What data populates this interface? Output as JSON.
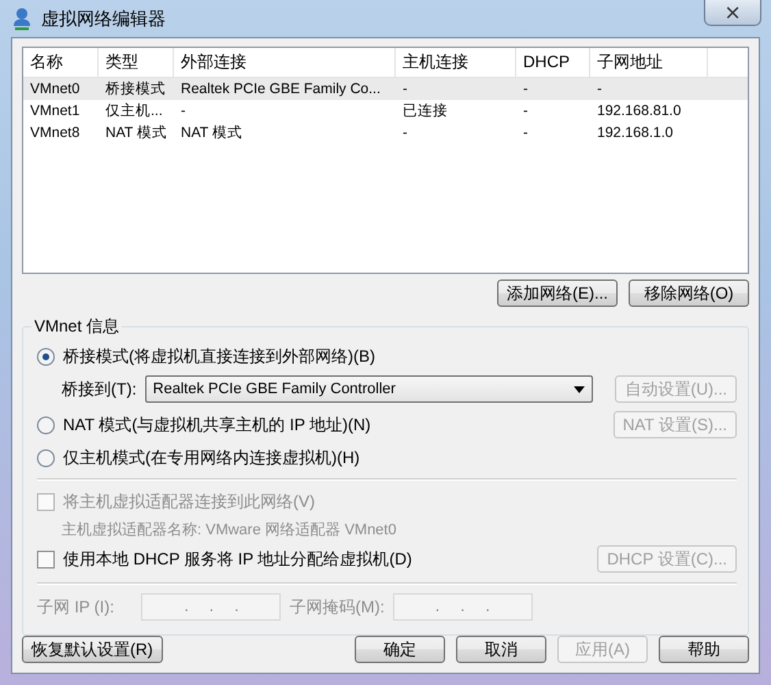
{
  "window": {
    "title": "虚拟网络编辑器",
    "close": "×"
  },
  "table": {
    "columns": [
      "名称",
      "类型",
      "外部连接",
      "主机连接",
      "DHCP",
      "子网地址"
    ],
    "rows": [
      {
        "cells": [
          "VMnet0",
          "桥接模式",
          "Realtek PCIe GBE Family Co...",
          "-",
          "-",
          "-"
        ],
        "selected": true
      },
      {
        "cells": [
          "VMnet1",
          "仅主机...",
          "-",
          "已连接",
          "-",
          "192.168.81.0"
        ],
        "selected": false
      },
      {
        "cells": [
          "VMnet8",
          "NAT 模式",
          "NAT 模式",
          "-",
          "-",
          "192.168.1.0"
        ],
        "selected": false
      }
    ]
  },
  "list_buttons": [
    {
      "label": "添加网络(E)...",
      "disabled": false
    },
    {
      "label": "移除网络(O)",
      "disabled": false
    }
  ],
  "group": {
    "title": "VMnet 信息",
    "modes": [
      {
        "label": "桥接模式(将虚拟机直接连接到外部网络)(B)",
        "selected": true
      },
      {
        "label": "NAT 模式(与虚拟机共享主机的 IP 地址)(N)",
        "selected": false
      },
      {
        "label": "仅主机模式(在专用网络内连接虚拟机)(H)",
        "selected": false
      }
    ],
    "bridge_label": "桥接到(T):",
    "bridge_value": "Realtek PCIe GBE Family Controller",
    "auto_button": {
      "label": "自动设置(U)...",
      "disabled": true
    },
    "nat_button": {
      "label": "NAT 设置(S)...",
      "disabled": true
    },
    "host_adapter": {
      "label": "将主机虚拟适配器连接到此网络(V)",
      "checked": false,
      "disabled": true
    },
    "adapter_name": {
      "text": "主机虚拟适配器名称: VMware 网络适配器 VMnet0",
      "disabled": true
    },
    "dhcp": {
      "label": "使用本地 DHCP 服务将 IP 地址分配给虚拟机(D)",
      "checked": false,
      "disabled": false
    },
    "dhcp_button": {
      "label": "DHCP 设置(C)...",
      "disabled": true
    },
    "subnet_ip": {
      "label": "子网 IP (I):",
      "value": ".     .     .",
      "disabled": true
    },
    "subnet_mask": {
      "label": "子网掩码(M):",
      "value": ".     .     .",
      "disabled": true
    }
  },
  "restore_button": {
    "label": "恢复默认设置(R)",
    "disabled": false
  },
  "buttons": [
    {
      "label": "确定",
      "disabled": false
    },
    {
      "label": "取消",
      "disabled": false
    },
    {
      "label": "应用(A)",
      "disabled": true
    },
    {
      "label": "帮助",
      "disabled": false
    }
  ]
}
